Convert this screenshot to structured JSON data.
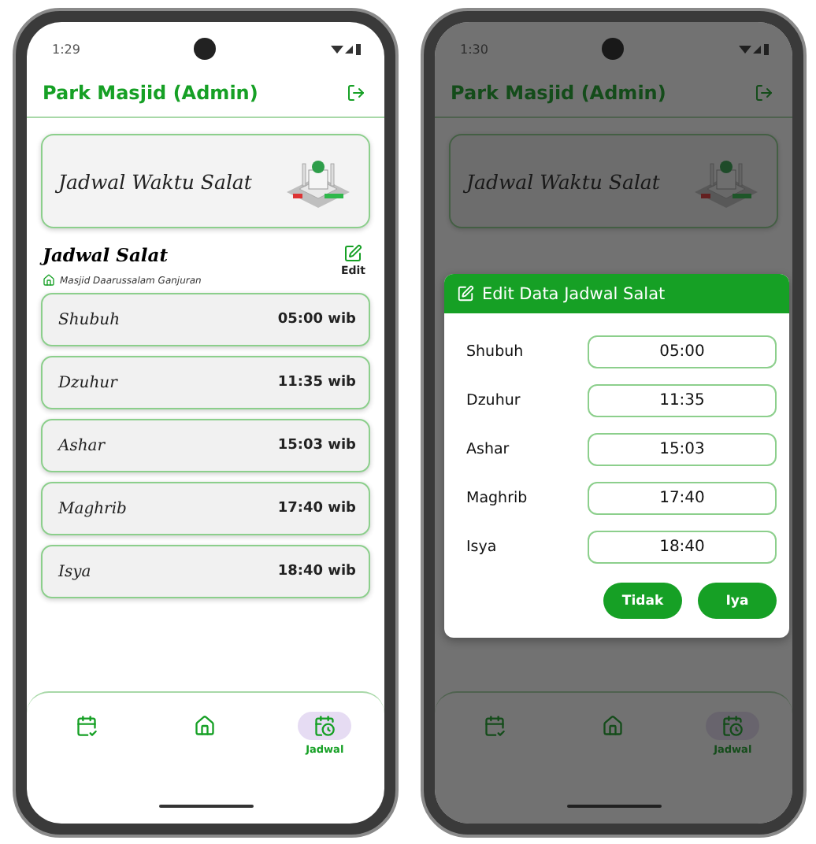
{
  "phones": [
    {
      "status_time": "1:29",
      "header": {
        "title": "Park Masjid (Admin)"
      },
      "hero": {
        "title": "Jadwal Waktu Salat"
      },
      "schedule": {
        "title": "Jadwal Salat",
        "location": "Masjid Daarussalam Ganjuran",
        "edit_label": "Edit",
        "rows": [
          {
            "name": "Shubuh",
            "time": "05:00 wib"
          },
          {
            "name": "Dzuhur",
            "time": "11:35 wib"
          },
          {
            "name": "Ashar",
            "time": "15:03 wib"
          },
          {
            "name": "Maghrib",
            "time": "17:40 wib"
          },
          {
            "name": "Isya",
            "time": "18:40 wib"
          }
        ]
      },
      "nav": [
        {
          "kind": "calendar",
          "selected": false
        },
        {
          "kind": "home",
          "selected": false
        },
        {
          "kind": "schedule",
          "label": "Jadwal",
          "selected": true
        }
      ]
    },
    {
      "status_time": "1:30",
      "header": {
        "title": "Park Masjid (Admin)"
      },
      "hero": {
        "title": "Jadwal Waktu Salat"
      },
      "dialog": {
        "title": "Edit Data Jadwal Salat",
        "fields": [
          {
            "label": "Shubuh",
            "value": "05:00"
          },
          {
            "label": "Dzuhur",
            "value": "11:35"
          },
          {
            "label": "Ashar",
            "value": "15:03"
          },
          {
            "label": "Maghrib",
            "value": "17:40"
          },
          {
            "label": "Isya",
            "value": "18:40"
          }
        ],
        "buttons": [
          "Tidak",
          "Iya"
        ]
      },
      "nav": [
        {
          "kind": "calendar",
          "selected": false
        },
        {
          "kind": "home",
          "selected": false
        },
        {
          "kind": "schedule",
          "label": "Jadwal",
          "selected": true
        }
      ]
    }
  ]
}
